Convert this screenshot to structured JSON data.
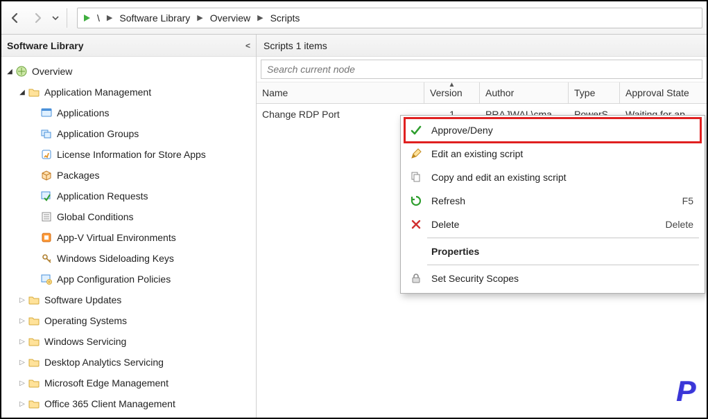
{
  "nav": {
    "back_tooltip": "Back",
    "forward_tooltip": "Forward",
    "dropdown_tooltip": "Recent",
    "breadcrumb_root": "\\",
    "breadcrumb": [
      "Software Library",
      "Overview",
      "Scripts"
    ]
  },
  "left_panel": {
    "title": "Software Library"
  },
  "tree": [
    {
      "level": 0,
      "expand": "down",
      "icon": "overview",
      "label": "Overview"
    },
    {
      "level": 1,
      "expand": "down",
      "icon": "folder",
      "label": "Application Management"
    },
    {
      "level": 2,
      "expand": "none",
      "icon": "app",
      "label": "Applications"
    },
    {
      "level": 2,
      "expand": "none",
      "icon": "appgrp",
      "label": "Application Groups"
    },
    {
      "level": 2,
      "expand": "none",
      "icon": "license",
      "label": "License Information for Store Apps"
    },
    {
      "level": 2,
      "expand": "none",
      "icon": "pkg",
      "label": "Packages"
    },
    {
      "level": 2,
      "expand": "none",
      "icon": "appreq",
      "label": "Application Requests"
    },
    {
      "level": 2,
      "expand": "none",
      "icon": "global",
      "label": "Global Conditions"
    },
    {
      "level": 2,
      "expand": "none",
      "icon": "appv",
      "label": "App-V Virtual Environments"
    },
    {
      "level": 2,
      "expand": "none",
      "icon": "keys",
      "label": "Windows Sideloading Keys"
    },
    {
      "level": 2,
      "expand": "none",
      "icon": "cfgpol",
      "label": "App Configuration Policies"
    },
    {
      "level": 1,
      "expand": "right",
      "icon": "folder",
      "label": "Software Updates"
    },
    {
      "level": 1,
      "expand": "right",
      "icon": "folder",
      "label": "Operating Systems"
    },
    {
      "level": 1,
      "expand": "right",
      "icon": "folder",
      "label": "Windows Servicing"
    },
    {
      "level": 1,
      "expand": "right",
      "icon": "folder",
      "label": "Desktop Analytics Servicing"
    },
    {
      "level": 1,
      "expand": "right",
      "icon": "folder",
      "label": "Microsoft Edge Management"
    },
    {
      "level": 1,
      "expand": "right",
      "icon": "folder",
      "label": "Office 365 Client Management"
    }
  ],
  "right_panel": {
    "title": "Scripts 1 items",
    "search_placeholder": "Search current node"
  },
  "columns": {
    "name": "Name",
    "version": "Version",
    "author": "Author",
    "type": "Type",
    "approval": "Approval State"
  },
  "rows": [
    {
      "name": "Change RDP Port",
      "version": "1",
      "author": "PRAJWAL\\cma...",
      "type": "PowerS...",
      "approval": "Waiting for ap..."
    }
  ],
  "context_menu": [
    {
      "icon": "check",
      "label": "Approve/Deny",
      "accel": "",
      "highlight": true
    },
    {
      "icon": "pencil",
      "label": "Edit an existing script",
      "accel": ""
    },
    {
      "icon": "copy",
      "label": "Copy and edit an existing script",
      "accel": ""
    },
    {
      "icon": "refresh",
      "label": "Refresh",
      "accel": "F5"
    },
    {
      "icon": "delete",
      "label": "Delete",
      "accel": "Delete"
    },
    {
      "sep": true
    },
    {
      "icon": "",
      "label": "Properties",
      "accel": "",
      "bold": true
    },
    {
      "sep": true
    },
    {
      "icon": "lock",
      "label": "Set Security Scopes",
      "accel": ""
    }
  ],
  "watermark": "P"
}
